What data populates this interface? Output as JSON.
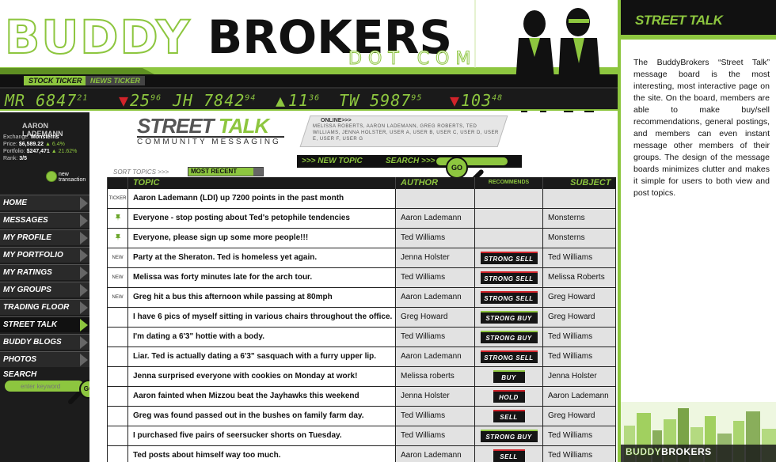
{
  "header": {
    "logo_buddy": "BUDDY",
    "logo_brokers": "BROKERS",
    "logo_dotcom": "DOT COM"
  },
  "ticker_tabs": {
    "stock": "STOCK TICKER",
    "news": "NEWS TICKER"
  },
  "ticker": [
    {
      "sym": "MR_6847",
      "frac": "21",
      "dir": "none"
    },
    {
      "sym": "25",
      "frac": "96",
      "dir": "down"
    },
    {
      "sym": "JH_7842",
      "frac": "94",
      "dir": "none"
    },
    {
      "sym": "11",
      "frac": "36",
      "dir": "up"
    },
    {
      "sym": "TW_5987",
      "frac": "95",
      "dir": "none"
    },
    {
      "sym": "103",
      "frac": "48",
      "dir": "down"
    }
  ],
  "user": {
    "name": "AARON LADEMANN",
    "exchange_label": "Exchange:",
    "exchange_value": "Monsterns",
    "price_label": "Price:",
    "price_value": "$6,589.22",
    "price_change": "6.4%",
    "portfolio_label": "Portfolio:",
    "portfolio_value": "$247,471",
    "portfolio_change": "21.62%",
    "rank_label": "Rank:",
    "rank_value": "3/5",
    "new_transaction": "new transaction"
  },
  "nav": [
    {
      "label": "HOME"
    },
    {
      "label": "MESSAGES"
    },
    {
      "label": "MY PROFILE"
    },
    {
      "label": "MY PORTFOLIO"
    },
    {
      "label": "MY RATINGS"
    },
    {
      "label": "MY GROUPS"
    },
    {
      "label": "TRADING FLOOR"
    },
    {
      "label": "STREET TALK"
    },
    {
      "label": "BUDDY BLOGS"
    },
    {
      "label": "PHOTOS"
    }
  ],
  "sidebar_search": {
    "label": "SEARCH",
    "placeholder": "enter keyword",
    "go": "GO"
  },
  "street_talk": {
    "title_a": "STREET",
    "title_b": "TALK",
    "subtitle": "COMMUNITY MESSAGING",
    "online_label": "ONLINE>>>",
    "online_names": "MELISSA ROBERTS,  AARON LADEMANN, GREG ROBERTS, TED WILLIAMS, JENNA HOLSTER, USER A, USER B, USER C, USER D, USER E, USER F, USER G",
    "new_topic": ">>> NEW TOPIC",
    "search": "SEARCH >>>",
    "go": "GO",
    "sort_label": "SORT TOPICS >>>",
    "sort_value": "MOST RECENT"
  },
  "table": {
    "headers": {
      "topic": "TOPIC",
      "author": "AUTHOR",
      "recommends": "RECOMMENDS",
      "subject": "SUBJECT"
    },
    "rows": [
      {
        "flag": "TICKER",
        "topic": "Aaron Lademann (LDI) up 7200 points in the past month",
        "author": "",
        "rec": "",
        "subject": ""
      },
      {
        "flag": "pin",
        "topic": "Everyone - stop posting about Ted's petophile tendencies",
        "author": "Aaron Lademann",
        "rec": "",
        "subject": "Monsterns"
      },
      {
        "flag": "pin",
        "topic": "Everyone, please sign up some more people!!!",
        "author": "Ted Williams",
        "rec": "",
        "subject": "Monsterns"
      },
      {
        "flag": "NEW",
        "topic": "Party at the Sheraton. Ted is homeless yet again.",
        "author": "Jenna Holster",
        "rec": "STRONG SELL",
        "subject": "Ted Williams"
      },
      {
        "flag": "NEW",
        "topic": "Melissa was forty minutes late for the arch tour.",
        "author": "Ted Williams",
        "rec": "STRONG SELL",
        "subject": "Melissa Roberts"
      },
      {
        "flag": "NEW",
        "topic": "Greg hit a bus this afternoon while passing at 80mph",
        "author": "Aaron Lademann",
        "rec": "STRONG SELL",
        "subject": "Greg Howard"
      },
      {
        "flag": "",
        "topic": "I have 6 pics of myself sitting in various chairs throughout the office.",
        "author": "Greg Howard",
        "rec": "STRONG BUY",
        "subject": "Greg Howard"
      },
      {
        "flag": "",
        "topic": "I'm dating a 6'3\" hottie with a body.",
        "author": "Ted Williams",
        "rec": "STRONG BUY",
        "subject": "Ted Williams"
      },
      {
        "flag": "",
        "topic": "Liar. Ted is actually dating a 6'3\" sasquach with a furry upper lip.",
        "author": "Aaron Lademann",
        "rec": "STRONG SELL",
        "subject": "Ted Williams"
      },
      {
        "flag": "",
        "topic": "Jenna surprised everyone with cookies on Monday at work!",
        "author": "Melissa roberts",
        "rec": "BUY",
        "subject": "Jenna Holster"
      },
      {
        "flag": "",
        "topic": "Aaron fainted when Mizzou beat the Jayhawks this weekend",
        "author": "Jenna Holster",
        "rec": "HOLD",
        "subject": "Aaron Lademann"
      },
      {
        "flag": "",
        "topic": "Greg was found passed out in the bushes on family farm day.",
        "author": "Ted Williams",
        "rec": "SELL",
        "subject": "Greg Howard"
      },
      {
        "flag": "",
        "topic": "I purchased five pairs of seersucker shorts on Tuesday.",
        "author": "Ted Williams",
        "rec": "STRONG BUY",
        "subject": "Ted Williams"
      },
      {
        "flag": "",
        "topic": "Ted posts about himself way too much.",
        "author": "Aaron Lademann",
        "rec": "SELL",
        "subject": "Ted Williams"
      }
    ]
  },
  "panel": {
    "title": "STREET TALK",
    "text": "The BuddyBrokers “Street Talk” message board is the most interesting, most interactive page on the site. On the board, members are able to make buy/sell recommendations, general postings, and members can even instant message other members of their groups. The design of the message boards minimizes clutter and makes it simple for users to both view and post topics.",
    "logo_a": "BUDDY",
    "logo_b": "BROKERS"
  },
  "colors": {
    "accent": "#8dc63f",
    "dark": "#1a1a1a",
    "sell": "#d1232a"
  }
}
